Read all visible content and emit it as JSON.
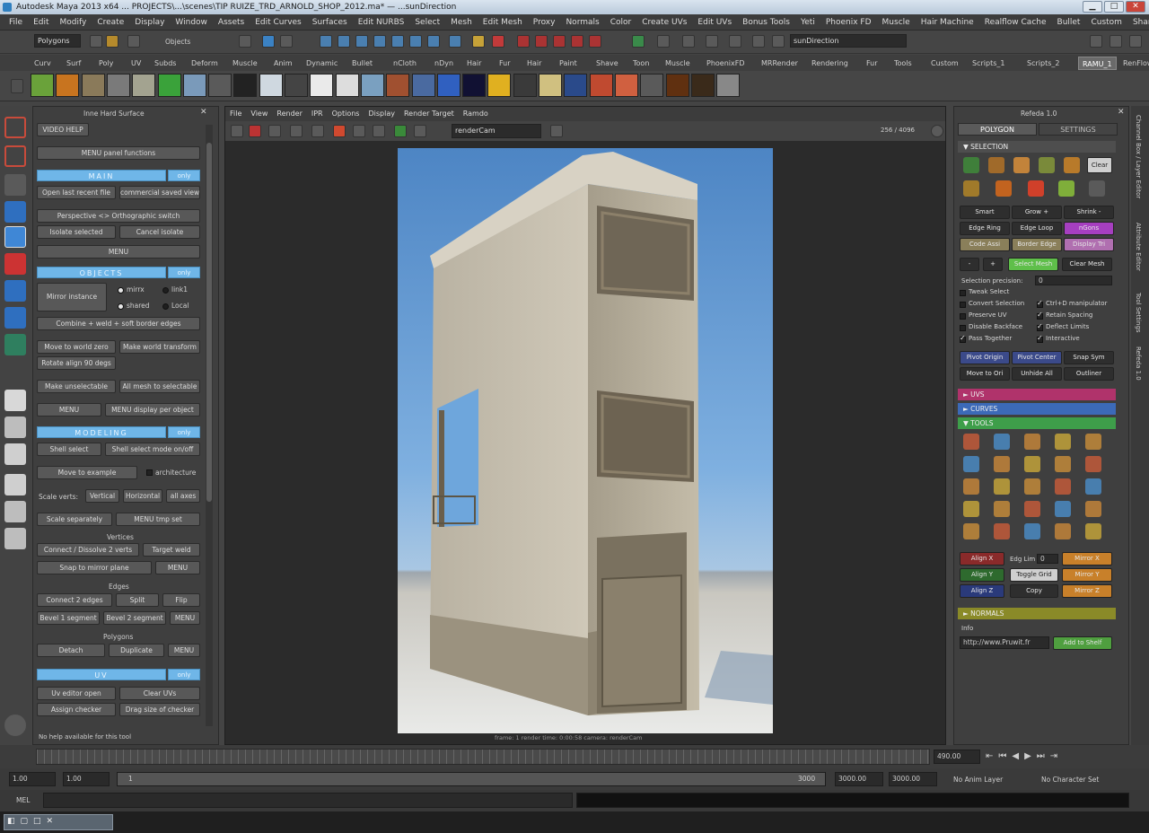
{
  "app": {
    "title": "Autodesk Maya 2013 x64 ... PROJECTS\\...\\scenes\\TIP RUIZE_TRD_ARNOLD_SHOP_2012.ma* — ...sunDirection"
  },
  "menubar": [
    "File",
    "Edit",
    "Modify",
    "Create",
    "Display",
    "Window",
    "Assets",
    "Edit Curves",
    "Surfaces",
    "Edit NURBS",
    "Select",
    "Mesh",
    "Edit Mesh",
    "Proxy",
    "Normals",
    "Color",
    "Create UVs",
    "Edit UVs",
    "Bonus Tools",
    "Yeti",
    "Phoenix FD",
    "Muscle",
    "Hair Machine",
    "Realflow Cache",
    "Bullet",
    "Custom",
    "Share"
  ],
  "statusline": {
    "mode": "Polygons",
    "objects_label": "Objects",
    "search_value": "sunDirection"
  },
  "shelf_tabs": [
    "Curv",
    "Surf",
    "Poly",
    "UV",
    "Subds",
    "Deform",
    "Muscle",
    "Anim",
    "Dynamic",
    "Bullet",
    "nCloth",
    "nDyn",
    "Hair",
    "Fur",
    "Hair",
    "Paint",
    "Shave",
    "Toon",
    "Muscle",
    "PhoenixFD",
    "MRRender",
    "Rendering",
    "Fur",
    "Tools",
    "Custom",
    "Scripts_1",
    "Scripts_2",
    "RAMU_1",
    "RenFlow"
  ],
  "shelf_active_tab": "RAMU_1",
  "leftpanel": {
    "title": "Inne Hard Surface",
    "video_help": "VIDEO HELP",
    "menu_panel": "MENU panel functions",
    "main_header": "MAIN",
    "main_aux": "only",
    "open_recent": "Open last recent file",
    "commercial_saved": "commercial saved view",
    "perspective": "Perspective <> Orthographic switch",
    "isolate_selected": "Isolate selected",
    "cancel_isolate": "Cancel isolate",
    "menu1": "MENU",
    "objects_header": "OBJECTS",
    "objects_aux": "only",
    "mirror_instance": "Mirror instance",
    "opt_x": "mirrx",
    "opt_y": "link1",
    "opt_z": "shared",
    "opt_w": "Local",
    "combine": "Combine + weld + soft border edges",
    "move_pivot": "Move to world zero",
    "make_transform": "Make world transform",
    "rotate_align": "Rotate align 90 degs",
    "make_unselectable": "Make unselectable",
    "all_to_selectable": "All mesh to selectable",
    "menu2": "MENU",
    "menu_display": "MENU display per object",
    "modeling_header": "MODELING",
    "modeling_aux": "only",
    "shell_select": "Shell select",
    "shell_select_mode": "Shell select mode on/off",
    "move_to_example": "Move to example",
    "architecture": "architecture",
    "scale_verts": "Scale verts:",
    "vertical": "Vertical",
    "horizontal": "Horizontal",
    "all_axis": "all axes",
    "scale_separately": "Scale separately",
    "menu_tmp": "MENU tmp set",
    "vertices_label": "Vertices",
    "connect_dissolve": "Connect / Dissolve 2 verts",
    "target_weld": "Target weld",
    "snap_mirror": "Snap to mirror plane",
    "menu3": "MENU",
    "edges_label": "Edges",
    "connect_edges": "Connect 2 edges",
    "split": "Split",
    "flip": "Flip",
    "bevel1": "Bevel 1 segment",
    "bevel2": "Bevel 2 segment",
    "menu4": "MENU",
    "polygons_label": "Polygons",
    "detach": "Detach",
    "duplicate": "Duplicate",
    "menu5": "MENU",
    "uv_header": "UV",
    "uv_aux": "only",
    "uv_editor": "Uv editor open",
    "clear_uvs": "Clear UVs",
    "assign_checker": "Assign checker",
    "drag_checker": "Drag size of checker",
    "status": "No help available for this tool"
  },
  "viewport": {
    "menu": [
      "File",
      "View",
      "Render",
      "IPR",
      "Options",
      "Display",
      "Render Target",
      "Ramdo"
    ],
    "camera_combo": "renderCam",
    "quality": "256 / 4096",
    "frame_info": "frame: 1   render time: 0:00:58   camera: renderCam"
  },
  "rightpanel": {
    "title": "Refeda 1.0",
    "tab_polygon": "POLYGON",
    "tab_settings": "SETTINGS",
    "selection_header": "SELECTION",
    "clear": "Clear",
    "smart": "Smart",
    "grow": "Grow +",
    "shrink": "Shrink -",
    "edge_ring": "Edge Ring",
    "edge_loop": "Edge Loop",
    "nguns": "nGons",
    "code_assi": "Code Assi",
    "border_edge": "Border Edge",
    "display_tri": "Display Tri",
    "minus": "-",
    "plus": "+",
    "select_mesh": "Select Mesh",
    "clear_mesh": "Clear Mesh",
    "selection_precision_label": "Selection precision:",
    "selection_precision_value": "0",
    "opts": [
      {
        "label": "Tweak Select",
        "on": false
      },
      {
        "label": "Convert Selection",
        "on": false
      },
      {
        "label": "Ctrl+D manipulator",
        "on": true
      },
      {
        "label": "Preserve UV",
        "on": false
      },
      {
        "label": "Retain Spacing",
        "on": true
      },
      {
        "label": "Disable Backface",
        "on": false
      },
      {
        "label": "Deflect Limits",
        "on": true
      },
      {
        "label": "Pass Together",
        "on": true
      },
      {
        "label": "Interactive",
        "on": true
      }
    ],
    "pivot_origin": "Pivot Origin",
    "pivot_center": "Pivot Center",
    "snap_sym": "Snap Sym",
    "move_to_orig": "Move to Ori",
    "unhide_all": "Unhide All",
    "outliner": "Outliner",
    "sec_uvs": "UVS",
    "sec_curves": "CURVES",
    "sec_tools": "TOOLS",
    "align_x": "Align X",
    "align_y": "Align Y",
    "align_z": "Align Z",
    "edg_lim": "Edg Lim",
    "edg_lim_val": "0",
    "toggle_grid": "Toggle Grid",
    "copy": "Copy",
    "mirror_x": "Mirror X",
    "mirror_y": "Mirror Y",
    "mirror_z": "Mirror Z",
    "normals_header": "NORMALS",
    "info_label": "Info",
    "url": "http://www.Pruwit.fr",
    "add_to_shelf": "Add to Shelf"
  },
  "rightstrip": [
    "Channel Box / Layer Editor",
    "Attribute Editor",
    "Tool Settings",
    "Refeda 1.0"
  ],
  "timeline": {
    "current": "490.00",
    "start": "1.00",
    "inner_start": "1.00",
    "range_start": "1",
    "range_end": "3000",
    "end": "3000.00",
    "end2": "3000.00",
    "anim_layer": "No Anim Layer",
    "char_set": "No Character Set"
  },
  "cmdline": {
    "label": "MEL"
  },
  "colors": {
    "accent_blue": "#6fb6e8",
    "uvs_section": "#b0336b",
    "curves_section": "#3c6ab8",
    "tools_section": "#3e9e4a",
    "normals_section": "#8a8a28"
  },
  "icons": [
    "select-tool-icon",
    "lasso-icon",
    "paint-select-icon",
    "move-icon",
    "rotate-icon",
    "scale-icon",
    "universal-manip-icon",
    "soft-mod-icon",
    "show-manip-icon",
    "render-view-icon",
    "play-icon"
  ]
}
